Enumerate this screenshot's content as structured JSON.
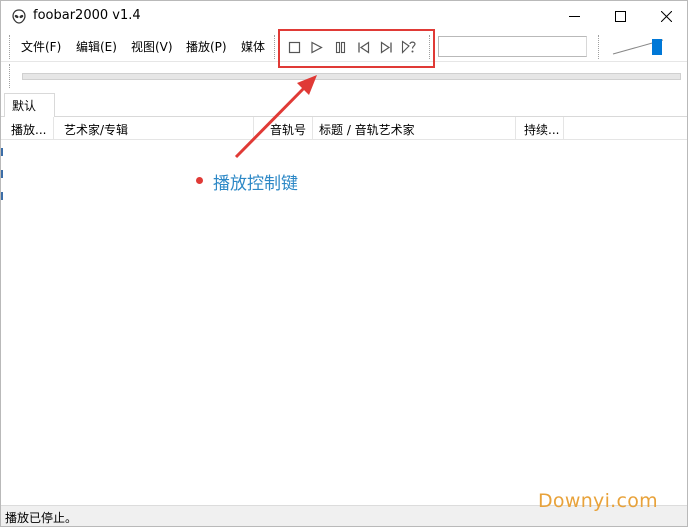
{
  "window": {
    "title": "foobar2000 v1.4"
  },
  "menu": {
    "items": [
      "文件(F)",
      "编辑(E)",
      "视图(V)",
      "播放(P)",
      "媒体"
    ]
  },
  "controls": {
    "icons": [
      "stop-icon",
      "play-icon",
      "pause-icon",
      "previous-icon",
      "next-icon",
      "random-icon"
    ]
  },
  "tabs": [
    {
      "label": "默认"
    }
  ],
  "playlist": {
    "columns": [
      "播放...",
      "艺术家/专辑",
      "音轨号",
      "标题 / 音轨艺术家",
      "持续..."
    ]
  },
  "annotation": {
    "label": "播放控制键"
  },
  "status": {
    "text": "播放已停止。"
  },
  "watermark": {
    "text": "Downyi.com"
  },
  "colors": {
    "accent": "#0078d7",
    "annotation_red": "#e03a36",
    "annotation_blue": "#2d88c6",
    "watermark": "#e8a23a"
  }
}
